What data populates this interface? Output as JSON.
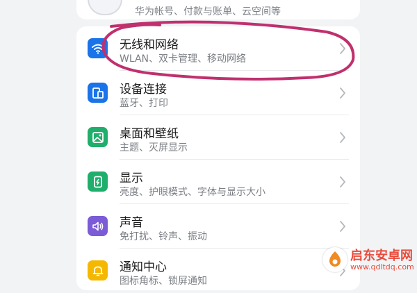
{
  "account": {
    "subtitle": "华为帐号、付款与账单、云空间等"
  },
  "settings": {
    "items": [
      {
        "title": "无线和网络",
        "subtitle": "WLAN、双卡管理、移动网络",
        "icon": "wifi-icon",
        "color": "#1a73e8"
      },
      {
        "title": "设备连接",
        "subtitle": "蓝牙、打印",
        "icon": "device-connection-icon",
        "color": "#1a73e8"
      },
      {
        "title": "桌面和壁纸",
        "subtitle": "主题、灭屏显示",
        "icon": "wallpaper-icon",
        "color": "#1fae6b"
      },
      {
        "title": "显示",
        "subtitle": "亮度、护眼模式、字体与显示大小",
        "icon": "display-icon",
        "color": "#1fae6b"
      },
      {
        "title": "声音",
        "subtitle": "免打扰、铃声、振动",
        "icon": "sound-icon",
        "color": "#7b5bd6"
      },
      {
        "title": "通知中心",
        "subtitle": "图标角标、锁屏通知",
        "icon": "bell-icon",
        "color": "#f5b800"
      }
    ]
  },
  "annotation": {
    "color": "#c0306e"
  },
  "watermark": {
    "title": "启东安卓网",
    "url": "www.qdltdq.com"
  }
}
